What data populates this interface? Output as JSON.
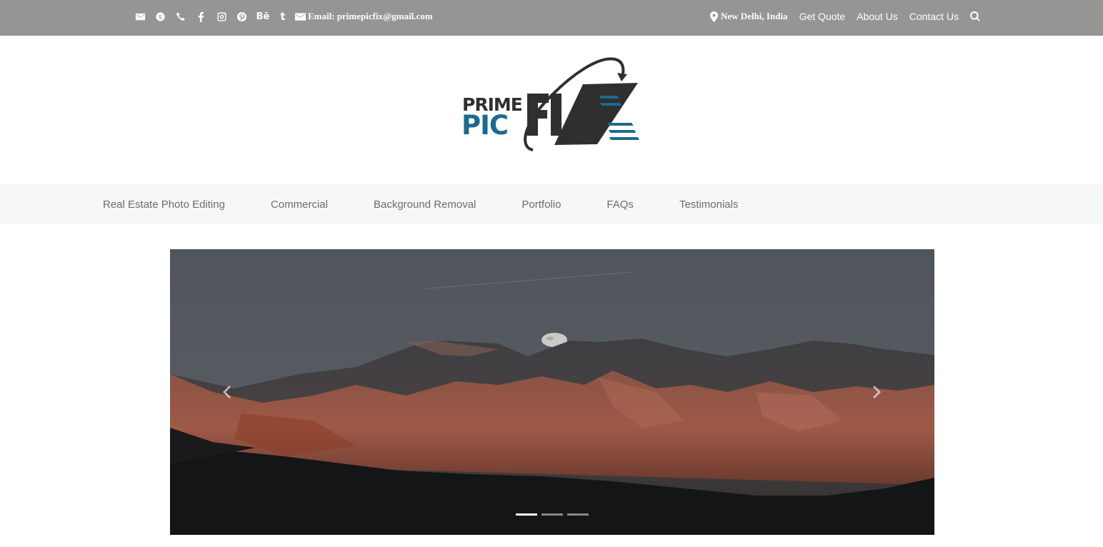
{
  "topbar": {
    "social_icons": [
      {
        "name": "envelope-icon"
      },
      {
        "name": "skype-icon"
      },
      {
        "name": "phone-icon"
      },
      {
        "name": "facebook-icon"
      },
      {
        "name": "instagram-icon"
      },
      {
        "name": "pinterest-icon"
      },
      {
        "name": "behance-icon",
        "glyph": "Bē"
      },
      {
        "name": "tumblr-icon",
        "glyph": "t"
      }
    ],
    "email_label": "Email: primepicfix@gmail.com",
    "location": "New Delhi, India",
    "links": [
      "Get Quote",
      "About Us",
      "Contact Us"
    ],
    "background_color": "#979593"
  },
  "logo": {
    "line1": "PRIME",
    "line2": "PIC",
    "line3": "FIX",
    "dark_color": "#2f2f2f",
    "accent_color": "#1c6a8f"
  },
  "nav": {
    "items": [
      "Real Estate Photo Editing",
      "Commercial",
      "Background Removal",
      "Portfolio",
      "FAQs",
      "Testimonials"
    ]
  },
  "slider": {
    "slide_count": 3,
    "active_index": 0,
    "image_description_icon": "mountain-landscape-image"
  }
}
